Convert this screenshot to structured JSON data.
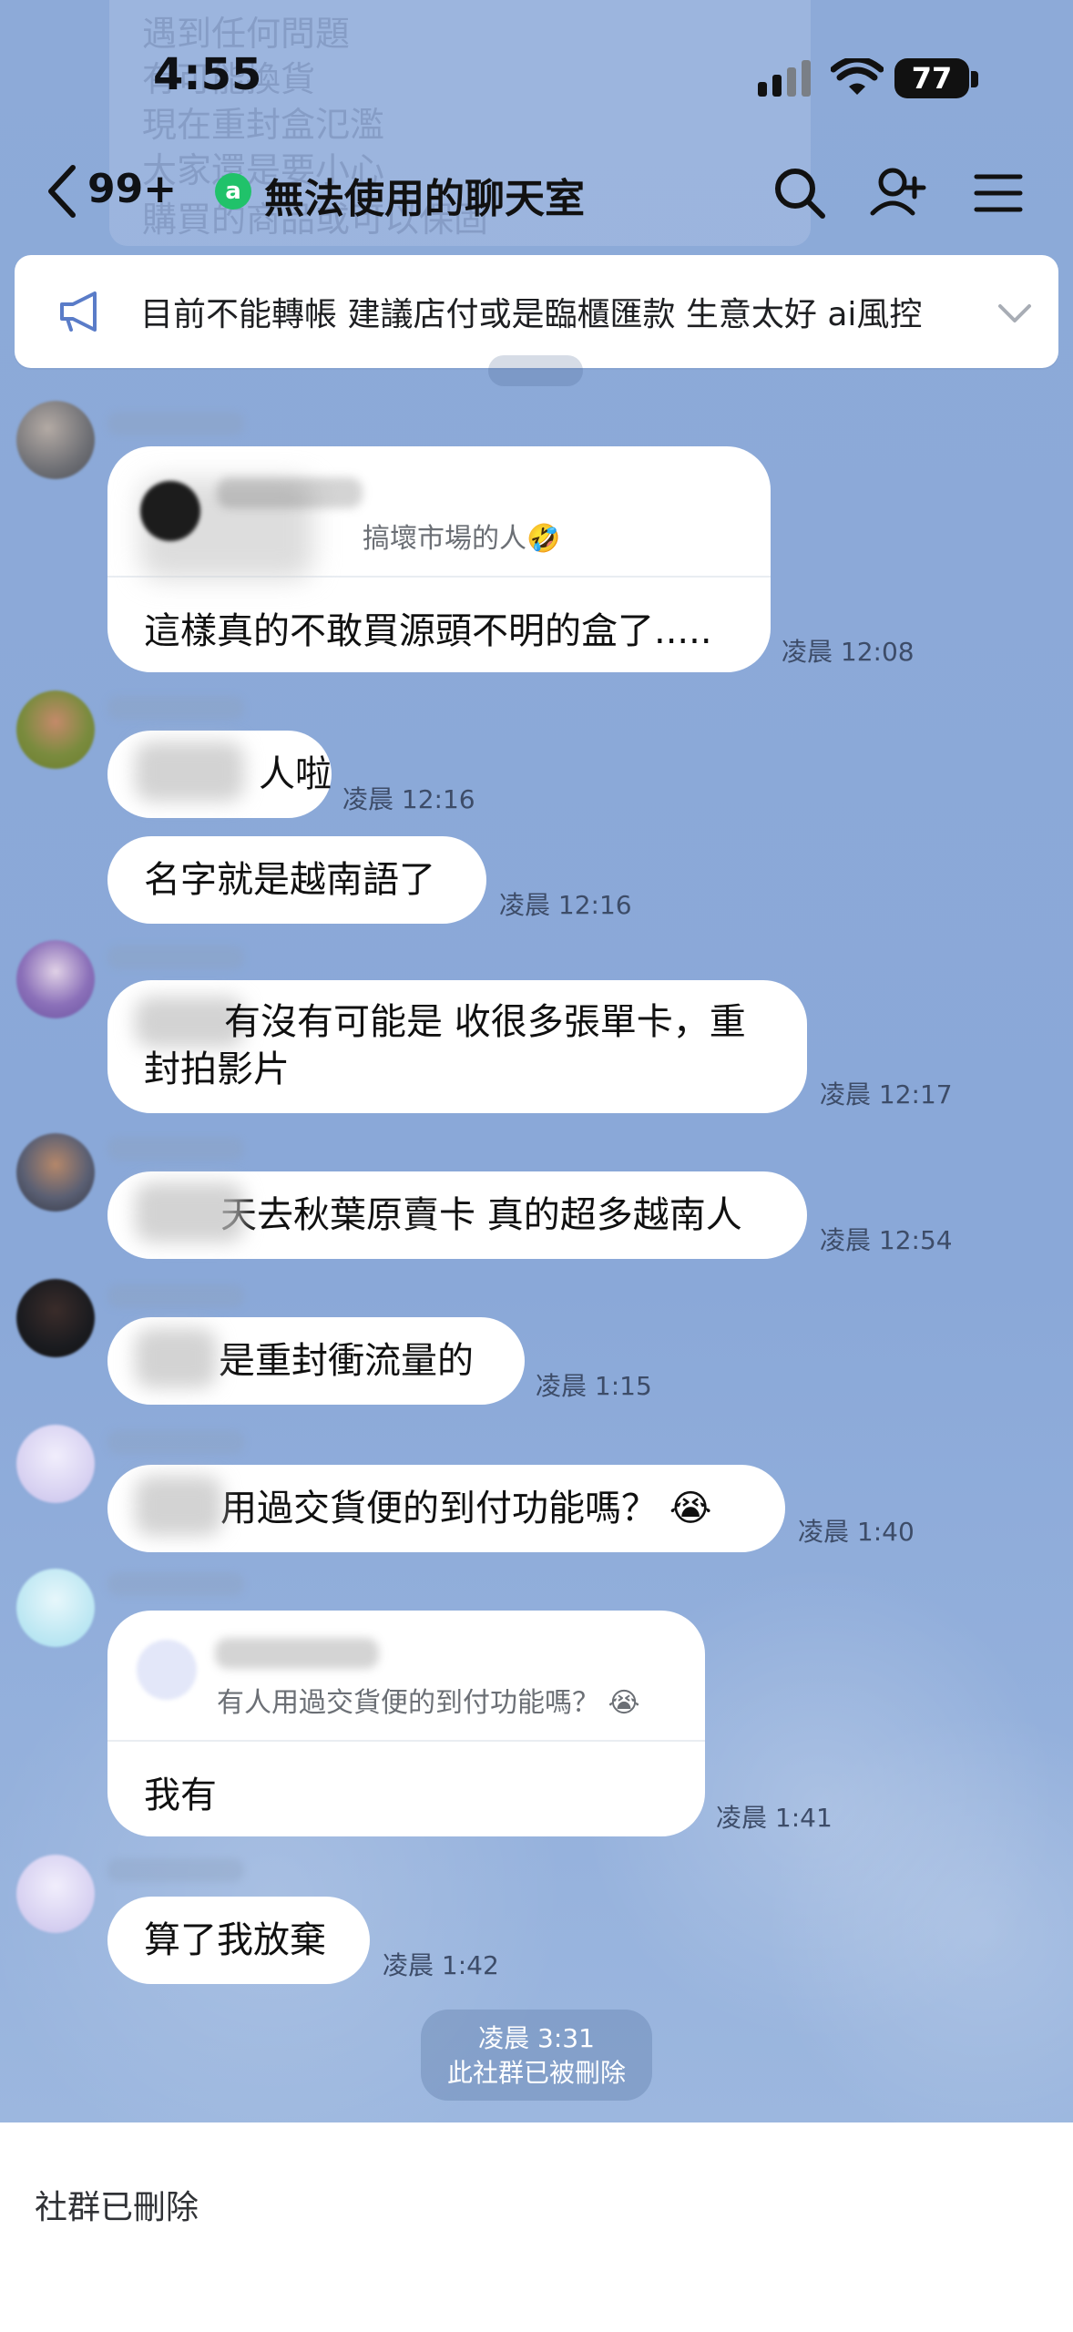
{
  "ghost_lines": [
    "遇到任何問題",
    "有可能換貨",
    "現在重封盒氾濫",
    "大家還是要小心",
    "購買的商品或可以保固"
  ],
  "status": {
    "time": "4:55",
    "battery": "77"
  },
  "header": {
    "unread": "99+",
    "openchat_glyph": "a",
    "title": "無法使用的聊天室"
  },
  "announcement": {
    "text": "目前不能轉帳 建議店付或是臨櫃匯款 生意太好 ai風控"
  },
  "messages": [
    {
      "reply_snippet": "搞壞市場的人🤣",
      "text": "這樣真的不敢買源頭不明的盒了.....",
      "time": "凌晨 12:08"
    },
    {
      "text": "人啦",
      "time": "凌晨 12:16"
    },
    {
      "text": "名字就是越南語了",
      "time": "凌晨 12:16"
    },
    {
      "text_line1": "有沒有可能是 收很多張單卡，重",
      "text_line2": "封拍影片",
      "time": "凌晨 12:17"
    },
    {
      "text": "天去秋葉原賣卡 真的超多越南人",
      "time": "凌晨 12:54"
    },
    {
      "text": "是重封衝流量的",
      "time": "凌晨 1:15"
    },
    {
      "text": "用過交貨便的到付功能嗎？ 😭",
      "time": "凌晨 1:40"
    },
    {
      "reply_snippet": "有人用過交貨便的到付功能嗎？ 😭",
      "text": "我有",
      "time": "凌晨 1:41"
    },
    {
      "text": "算了我放棄",
      "time": "凌晨 1:42"
    }
  ],
  "system": {
    "time": "凌晨 3:31",
    "text": "此社群已被刪除"
  },
  "footer": {
    "text": "社群已刪除"
  },
  "colors": {
    "background": "#8aa9d9",
    "bubble": "#ffffff",
    "openchat": "#20c26a",
    "announcement_icon": "#5a7cc8"
  }
}
